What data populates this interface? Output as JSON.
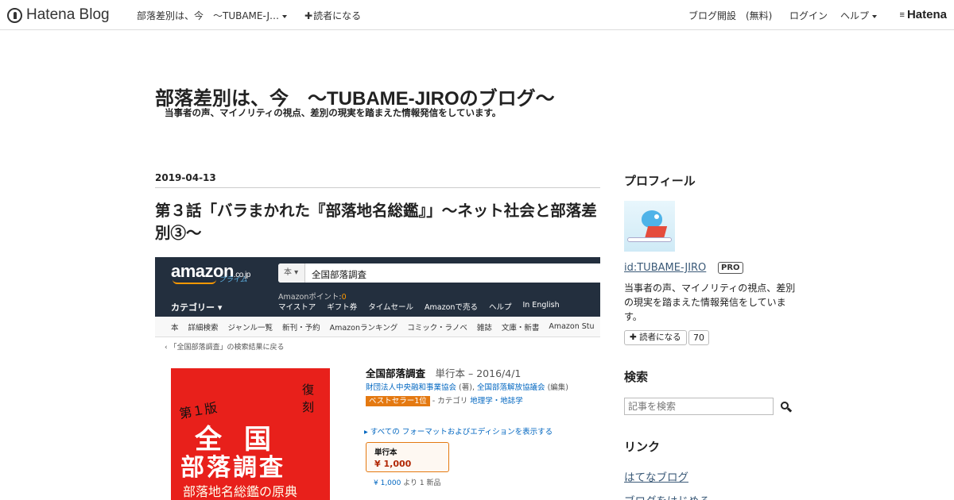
{
  "topbar": {
    "logo_text": "Hatena Blog",
    "blog_dropdown": "部落差別は、今　～TUBAME-J…",
    "subscribe": "読者になる",
    "open_blog": "ブログ開設　(無料)",
    "login": "ログイン",
    "help": "ヘルプ",
    "brand": "Hatena"
  },
  "header": {
    "title": "部落差別は、今　～TUBAME-JIROのブログ～",
    "description": "当事者の声、マイノリティの視点、差別の現実を踏まえた情報発信をしています。"
  },
  "entry": {
    "date": "2019-04-13",
    "title": "第３話「バラまかれた『部落地名総鑑』」～ネット社会と部落差別③～"
  },
  "amazon_shot": {
    "logo": "amazon",
    "logo_suffix": ".co.jp",
    "prime": "プライム",
    "search_category": "本",
    "search_query": "全国部落調査",
    "points_label": "Amazonポイント:",
    "points_value": "0",
    "category_label": "カテゴリー",
    "nav_links": [
      "マイストア",
      "ギフト券",
      "タイムセール",
      "Amazonで売る",
      "ヘルプ",
      "In English"
    ],
    "subnav": [
      "本",
      "詳細検索",
      "ジャンル一覧",
      "新刊・予約",
      "Amazonランキング",
      "コミック・ラノベ",
      "雑誌",
      "文庫・新書",
      "Amazon Stu"
    ],
    "back_link": "‹ 「全国部落調査」の検索結果に戻る",
    "book_cover": {
      "edition": "第１版",
      "reprint": "復刻",
      "line1": "全国",
      "line2": "部落調査",
      "line3": "部落地名総鑑の原典"
    },
    "product_title": "全国部落調査",
    "product_format": "単行本 – 2016/4/1",
    "authors": "財団法人中央融和事業協会",
    "author_role1": "(著),",
    "authors2": "全国部落解放協議会",
    "author_role2": "(編集)",
    "bestseller": "ベストセラー1位",
    "category_prefix": "- カテゴリ",
    "category": "地理学・地誌学",
    "editions_link": "▸ すべての フォーマットおよびエディションを表示する",
    "price_label": "単行本",
    "price": "¥ 1,000",
    "used_price": "¥ 1,000",
    "used_suffix": "より 1 新品"
  },
  "sidebar": {
    "profile_heading": "プロフィール",
    "profile_id": "id:TUBAME-JIRO",
    "pro_badge": "PRO",
    "profile_desc": "当事者の声、マイノリティの視点、差別の現実を踏まえた情報発信をしています。",
    "subscribe_button": "読者になる",
    "subscriber_count": "70",
    "search_heading": "検索",
    "search_placeholder": "記事を検索",
    "links_heading": "リンク",
    "links": [
      "はてなブログ",
      "ブログをはじめる"
    ]
  },
  "colors": {
    "amazon_nav": "#232f3e",
    "amazon_orange": "#e47911",
    "book_red": "#e8201b",
    "link": "#3b5a78"
  }
}
